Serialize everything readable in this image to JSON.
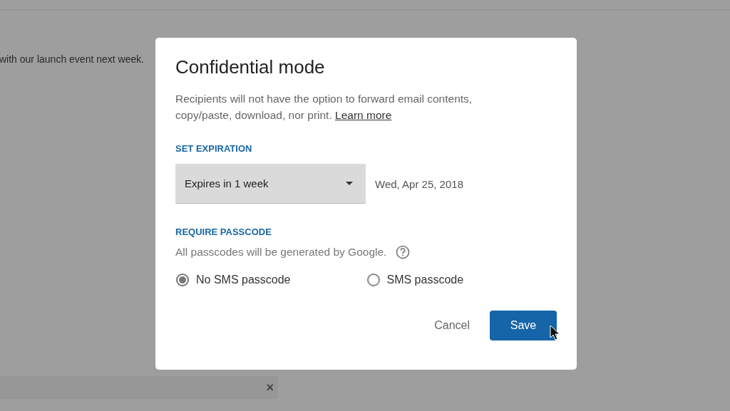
{
  "background": {
    "message": "with our launch event next week.",
    "close": "×"
  },
  "dialog": {
    "title": "Confidential mode",
    "description": "Recipients will not have the option to forward email contents, copy/paste, download, nor print.",
    "link": "Learn more",
    "expiration": {
      "label": "SET EXPIRATION",
      "dropdown": {
        "value": "Expires in 1 week"
      },
      "date": "Wed, Apr 25, 2018"
    },
    "passcode": {
      "label": "REQUIRE PASSCODE",
      "hint": "All passcodes will be generated by Google.",
      "options": [
        {
          "label": "No SMS passcode",
          "selected": true
        },
        {
          "label": "SMS passcode",
          "selected": false
        }
      ]
    },
    "buttons": [
      {
        "label": "Cancel",
        "kind": "text"
      },
      {
        "label": "Save",
        "kind": "primary"
      }
    ]
  }
}
